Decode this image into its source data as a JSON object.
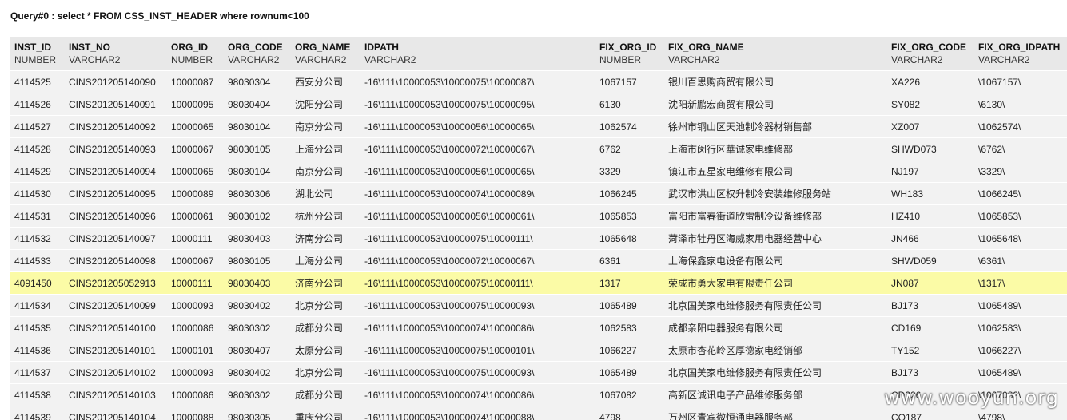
{
  "query": {
    "title": "Query#0 : select * FROM CSS_INST_HEADER where rownum<100"
  },
  "columns": [
    {
      "name": "INST_ID",
      "type": "NUMBER"
    },
    {
      "name": "INST_NO",
      "type": "VARCHAR2"
    },
    {
      "name": "ORG_ID",
      "type": "NUMBER"
    },
    {
      "name": "ORG_CODE",
      "type": "VARCHAR2"
    },
    {
      "name": "ORG_NAME",
      "type": "VARCHAR2"
    },
    {
      "name": "IDPATH",
      "type": "VARCHAR2"
    },
    {
      "name": "FIX_ORG_ID",
      "type": "NUMBER"
    },
    {
      "name": "FIX_ORG_NAME",
      "type": "VARCHAR2"
    },
    {
      "name": "FIX_ORG_CODE",
      "type": "VARCHAR2"
    },
    {
      "name": "FIX_ORG_IDPATH",
      "type": "VARCHAR2"
    }
  ],
  "rows": [
    {
      "highlight": false,
      "cells": [
        "4114525",
        "CINS201205140090",
        "10000087",
        "98030304",
        "西安分公司",
        "-16\\111\\10000053\\10000075\\10000087\\",
        "1067157",
        "银川百思购商贸有限公司",
        "XA226",
        "\\1067157\\"
      ]
    },
    {
      "highlight": false,
      "cells": [
        "4114526",
        "CINS201205140091",
        "10000095",
        "98030404",
        "沈阳分公司",
        "-16\\111\\10000053\\10000075\\10000095\\",
        "6130",
        "沈阳新鹏宏商贸有限公司",
        "SY082",
        "\\6130\\"
      ]
    },
    {
      "highlight": false,
      "cells": [
        "4114527",
        "CINS201205140092",
        "10000065",
        "98030104",
        "南京分公司",
        "-16\\111\\10000053\\10000056\\10000065\\",
        "1062574",
        "徐州市铜山区天池制冷器材销售部",
        "XZ007",
        "\\1062574\\"
      ]
    },
    {
      "highlight": false,
      "cells": [
        "4114528",
        "CINS201205140093",
        "10000067",
        "98030105",
        "上海分公司",
        "-16\\111\\10000053\\10000072\\10000067\\",
        "6762",
        "上海市闵行区華诚家电维修部",
        "SHWD073",
        "\\6762\\"
      ]
    },
    {
      "highlight": false,
      "cells": [
        "4114529",
        "CINS201205140094",
        "10000065",
        "98030104",
        "南京分公司",
        "-16\\111\\10000053\\10000056\\10000065\\",
        "3329",
        "镇江市五星家电维修有限公司",
        "NJ197",
        "\\3329\\"
      ]
    },
    {
      "highlight": false,
      "cells": [
        "4114530",
        "CINS201205140095",
        "10000089",
        "98030306",
        "湖北公司",
        "-16\\111\\10000053\\10000074\\10000089\\",
        "1066245",
        "武汉市洪山区权升制冷安装维修服务站",
        "WH183",
        "\\1066245\\"
      ]
    },
    {
      "highlight": false,
      "cells": [
        "4114531",
        "CINS201205140096",
        "10000061",
        "98030102",
        "杭州分公司",
        "-16\\111\\10000053\\10000056\\10000061\\",
        "1065853",
        "富阳市富春街道欣雷制冷设备维修部",
        "HZ410",
        "\\1065853\\"
      ]
    },
    {
      "highlight": false,
      "cells": [
        "4114532",
        "CINS201205140097",
        "10000111",
        "98030403",
        "济南分公司",
        "-16\\111\\10000053\\10000075\\10000111\\",
        "1065648",
        "菏泽市牡丹区海威家用电器经营中心",
        "JN466",
        "\\1065648\\"
      ]
    },
    {
      "highlight": false,
      "cells": [
        "4114533",
        "CINS201205140098",
        "10000067",
        "98030105",
        "上海分公司",
        "-16\\111\\10000053\\10000072\\10000067\\",
        "6361",
        "上海保鑫家电设备有限公司",
        "SHWD059",
        "\\6361\\"
      ]
    },
    {
      "highlight": true,
      "cells": [
        "4091450",
        "CINS201205052913",
        "10000111",
        "98030403",
        "济南分公司",
        "-16\\111\\10000053\\10000075\\10000111\\",
        "1317",
        "荣成市勇大家电有限责任公司",
        "JN087",
        "\\1317\\"
      ]
    },
    {
      "highlight": false,
      "cells": [
        "4114534",
        "CINS201205140099",
        "10000093",
        "98030402",
        "北京分公司",
        "-16\\111\\10000053\\10000075\\10000093\\",
        "1065489",
        "北京国美家电维修服务有限责任公司",
        "BJ173",
        "\\1065489\\"
      ]
    },
    {
      "highlight": false,
      "cells": [
        "4114535",
        "CINS201205140100",
        "10000086",
        "98030302",
        "成都分公司",
        "-16\\111\\10000053\\10000074\\10000086\\",
        "1062583",
        "成都亲阳电器服务有限公司",
        "CD169",
        "\\1062583\\"
      ]
    },
    {
      "highlight": false,
      "cells": [
        "4114536",
        "CINS201205140101",
        "10000101",
        "98030407",
        "太原分公司",
        "-16\\111\\10000053\\10000075\\10000101\\",
        "1066227",
        "太原市杏花岭区厚德家电经销部",
        "TY152",
        "\\1066227\\"
      ]
    },
    {
      "highlight": false,
      "cells": [
        "4114537",
        "CINS201205140102",
        "10000093",
        "98030402",
        "北京分公司",
        "-16\\111\\10000053\\10000075\\10000093\\",
        "1065489",
        "北京国美家电维修服务有限责任公司",
        "BJ173",
        "\\1065489\\"
      ]
    },
    {
      "highlight": false,
      "cells": [
        "4114538",
        "CINS201205140103",
        "10000086",
        "98030302",
        "成都分公司",
        "-16\\111\\10000053\\10000074\\10000086\\",
        "1067082",
        "高新区诚讯电子产品维修服务部",
        "CD226",
        "\\1067082\\"
      ]
    },
    {
      "highlight": false,
      "cells": [
        "4114539",
        "CINS201205140104",
        "10000088",
        "98030305",
        "重庆分公司",
        "-16\\111\\10000053\\10000074\\10000088\\",
        "4798",
        "万州区青宾微恒通电器服务部",
        "CQ187",
        "\\4798\\"
      ]
    }
  ],
  "watermark": "www.wooyun.org",
  "colors": {
    "header_bg": "#e8e8e8",
    "row_bg": "#f2f2f2",
    "highlight_bg": "#fbfba6"
  }
}
